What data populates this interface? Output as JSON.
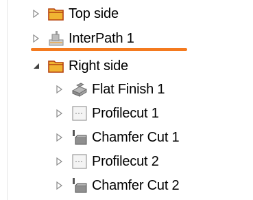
{
  "tree": {
    "items": [
      {
        "label": "Top side",
        "expanded": false,
        "icon": "folder-icon"
      },
      {
        "label": "InterPath 1",
        "expanded": false,
        "icon": "interpath-icon",
        "highlighted": true
      },
      {
        "label": "Right side",
        "expanded": true,
        "icon": "folder-icon"
      },
      {
        "label": "Flat Finish 1",
        "expanded": false,
        "icon": "flat-finish-icon"
      },
      {
        "label": "Profilecut 1",
        "expanded": false,
        "icon": "profilecut-icon"
      },
      {
        "label": "Chamfer Cut 1",
        "expanded": false,
        "icon": "chamfer-cut-icon"
      },
      {
        "label": "Profilecut 2",
        "expanded": false,
        "icon": "profilecut-icon"
      },
      {
        "label": "Chamfer Cut 2",
        "expanded": false,
        "icon": "chamfer-cut-icon"
      }
    ]
  },
  "colors": {
    "highlight_underline": "#f47a1f",
    "folder_fill": "#f0b432",
    "folder_outline": "#b5420f",
    "arrow": "#8a8a8a"
  }
}
